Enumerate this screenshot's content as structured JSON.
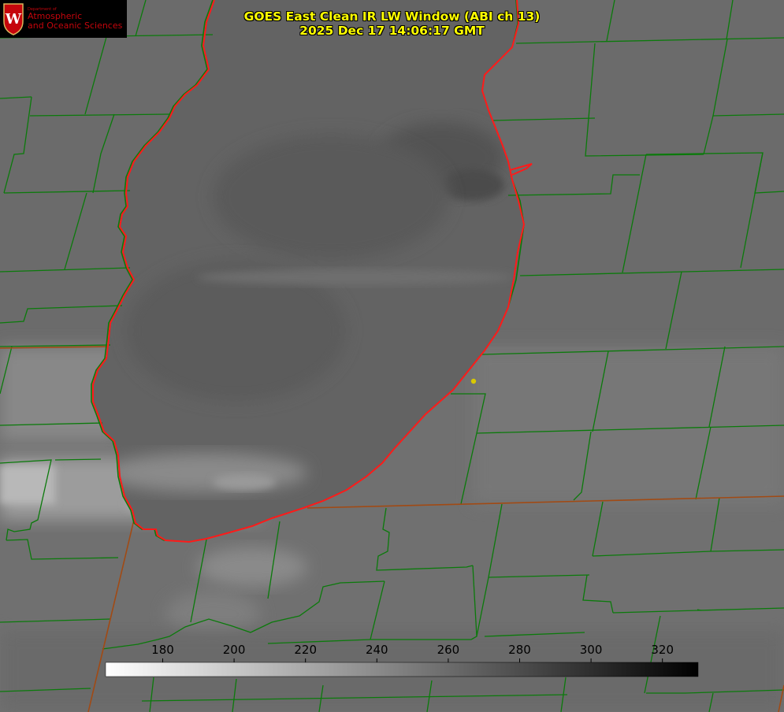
{
  "header": {
    "title": "GOES East Clean IR LW Window (ABI ch 13)",
    "timestamp": "2025 Dec 17 14:06:17 GMT"
  },
  "logo": {
    "icon": "uw-crest-icon",
    "department": "Department of",
    "name_line1": "Atmospheric",
    "name_line2": "and Oceanic Sciences",
    "color": "#c5050c"
  },
  "colorbar": {
    "ticks": [
      "180",
      "200",
      "220",
      "240",
      "260",
      "280",
      "300",
      "320"
    ],
    "value_range": [
      164,
      330
    ],
    "gradient": "white-to-black"
  },
  "colors": {
    "county_lines": "#0b7a0b",
    "state_lines": "#a14a14",
    "lake_shoreline": "#ff1a1a",
    "marker": "#d8c800",
    "title_text": "#ffff00"
  }
}
